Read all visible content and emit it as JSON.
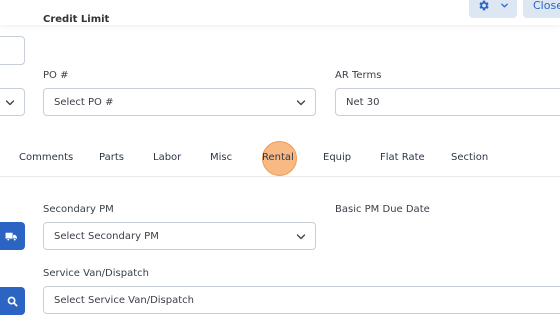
{
  "header": {
    "credit_limit_label": "Credit Limit",
    "close_label": "Close"
  },
  "form": {
    "po_label": "PO #",
    "po_placeholder": "Select PO #",
    "ar_terms_label": "AR Terms",
    "ar_terms_value": "Net 30",
    "secondary_pm_label": "Secondary PM",
    "secondary_pm_placeholder": "Select Secondary PM",
    "basic_pm_due_label": "Basic PM Due Date",
    "service_van_label": "Service Van/Dispatch",
    "service_van_placeholder": "Select Service Van/Dispatch"
  },
  "tabs": [
    {
      "label": "Comments"
    },
    {
      "label": "Parts"
    },
    {
      "label": "Labor"
    },
    {
      "label": "Misc"
    },
    {
      "label": "Rental",
      "highlighted": true
    },
    {
      "label": "Equip"
    },
    {
      "label": "Flat Rate"
    },
    {
      "label": "Section"
    }
  ],
  "colors": {
    "primary": "#2b64c3",
    "highlight": "#f6a563",
    "secondary_button_bg": "#dde6f3"
  },
  "icons": [
    "gear-icon",
    "chevron-down-icon",
    "truck-icon",
    "search-icon"
  ]
}
